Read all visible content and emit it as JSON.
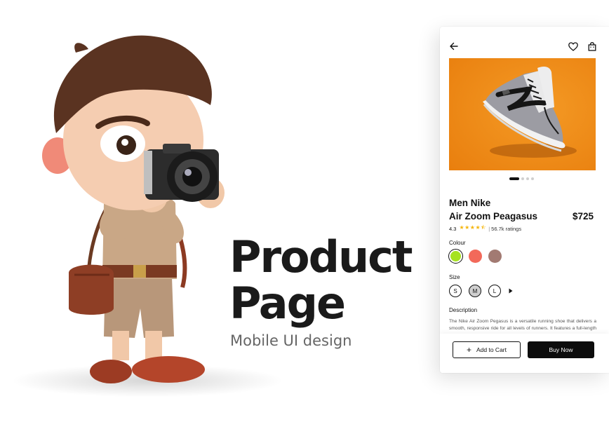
{
  "headline": {
    "line1": "Product",
    "line2": "Page",
    "subtitle": "Mobile UI design"
  },
  "phone": {
    "topbar": {
      "back_icon": "arrow-left-icon",
      "wishlist_icon": "heart-icon",
      "cart_icon": "shopping-bag-icon"
    },
    "product": {
      "brand": "Men Nike",
      "name": "Air Zoom Peagasus",
      "price": "$725",
      "rating_value": "4.3",
      "stars": "★★★★⯪",
      "ratings_count": "56.7k ratings",
      "rating_separator": "|"
    },
    "carousel": {
      "total_slides": 4,
      "active_index": 0
    },
    "colour": {
      "label": "Colour",
      "options": [
        "#a6e21f",
        "#f2695a",
        "#a27a72"
      ],
      "selected_index": 0
    },
    "size": {
      "label": "Size",
      "options": [
        "S",
        "M",
        "L"
      ],
      "selected_index": 1,
      "more_icon": "caret-right-icon"
    },
    "description": {
      "label": "Description",
      "text": "The Nike Air Zoom Pegasus is a versatile running shoe that delivers a smooth, responsive ride for all levels of runners. It features a full-length Zoom Air unit in the heel for cushioning"
    },
    "actions": {
      "add_to_cart": "Add to Cart",
      "add_icon": "plus-icon",
      "buy_now": "Buy Now"
    }
  },
  "colors": {
    "hero_background": "#f08c18",
    "primary_button": "#0c0c0c",
    "star": "#f5b50a"
  }
}
